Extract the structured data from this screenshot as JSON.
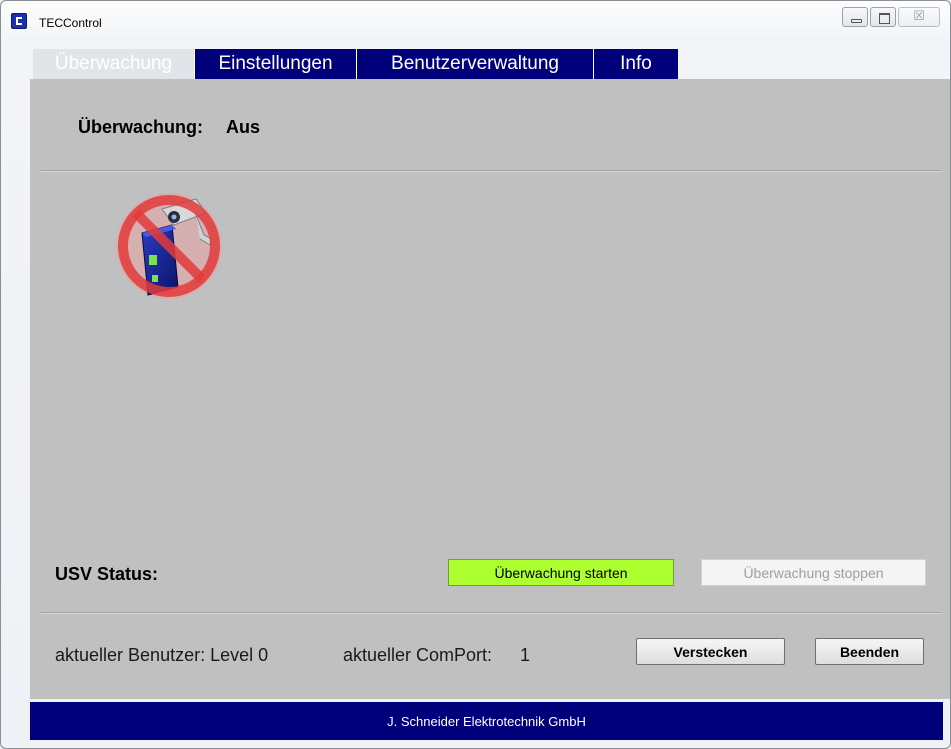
{
  "window": {
    "title": "TECControl",
    "app_icon": "app-logo-icon",
    "controls": {
      "minimize": "minimize-icon",
      "maximize": "maximize-icon",
      "close": "close-icon"
    },
    "close_glyph": "☒"
  },
  "tabs": [
    {
      "label": "Überwachung",
      "active": true
    },
    {
      "label": "Einstellungen",
      "active": false
    },
    {
      "label": "Benutzerverwaltung",
      "active": false
    },
    {
      "label": "Info",
      "active": false
    }
  ],
  "monitoring": {
    "label": "Überwachung:",
    "value": "Aus",
    "status_icon": "monitoring-off-icon"
  },
  "usv": {
    "label": "USV Status:"
  },
  "buttons": {
    "start": "Überwachung starten",
    "stop": "Überwachung stoppen",
    "hide": "Verstecken",
    "quit": "Beenden"
  },
  "status_bar": {
    "user": "aktueller Benutzer: Level 0",
    "comport_label": "aktueller ComPort:",
    "comport_value": "1"
  },
  "footer": {
    "text": "J. Schneider Elektrotechnik GmbH"
  },
  "colors": {
    "tab_bg": "#00007a",
    "content_bg": "#c0c0c0",
    "start_button": "#adff2f",
    "prohibition_red": "#e23b3b"
  }
}
